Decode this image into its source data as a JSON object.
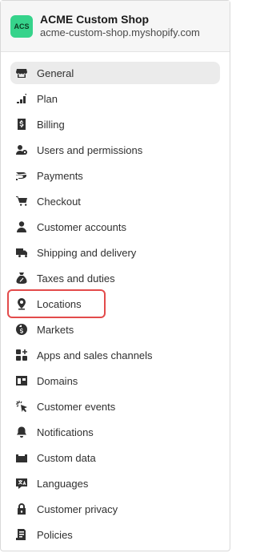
{
  "shop": {
    "avatar_initials": "ACS",
    "name": "ACME Custom Shop",
    "domain": "acme-custom-shop.myshopify.com",
    "avatar_color": "#36d38b"
  },
  "nav": {
    "active": "General",
    "highlighted": "Locations",
    "highlight_color": "#e34b4b",
    "items": [
      {
        "label": "General",
        "icon": "store-icon"
      },
      {
        "label": "Plan",
        "icon": "plan-bars-icon"
      },
      {
        "label": "Billing",
        "icon": "dollar-icon"
      },
      {
        "label": "Users and permissions",
        "icon": "users-icon"
      },
      {
        "label": "Payments",
        "icon": "payments-icon"
      },
      {
        "label": "Checkout",
        "icon": "cart-icon"
      },
      {
        "label": "Customer accounts",
        "icon": "person-icon"
      },
      {
        "label": "Shipping and delivery",
        "icon": "truck-icon"
      },
      {
        "label": "Taxes and duties",
        "icon": "tax-bag-icon"
      },
      {
        "label": "Locations",
        "icon": "location-pin-icon"
      },
      {
        "label": "Markets",
        "icon": "globe-dollar-icon"
      },
      {
        "label": "Apps and sales channels",
        "icon": "apps-icon"
      },
      {
        "label": "Domains",
        "icon": "domain-icon"
      },
      {
        "label": "Customer events",
        "icon": "cursor-click-icon"
      },
      {
        "label": "Notifications",
        "icon": "bell-icon"
      },
      {
        "label": "Custom data",
        "icon": "database-icon"
      },
      {
        "label": "Languages",
        "icon": "languages-icon"
      },
      {
        "label": "Customer privacy",
        "icon": "lock-icon"
      },
      {
        "label": "Policies",
        "icon": "policies-icon"
      }
    ]
  }
}
